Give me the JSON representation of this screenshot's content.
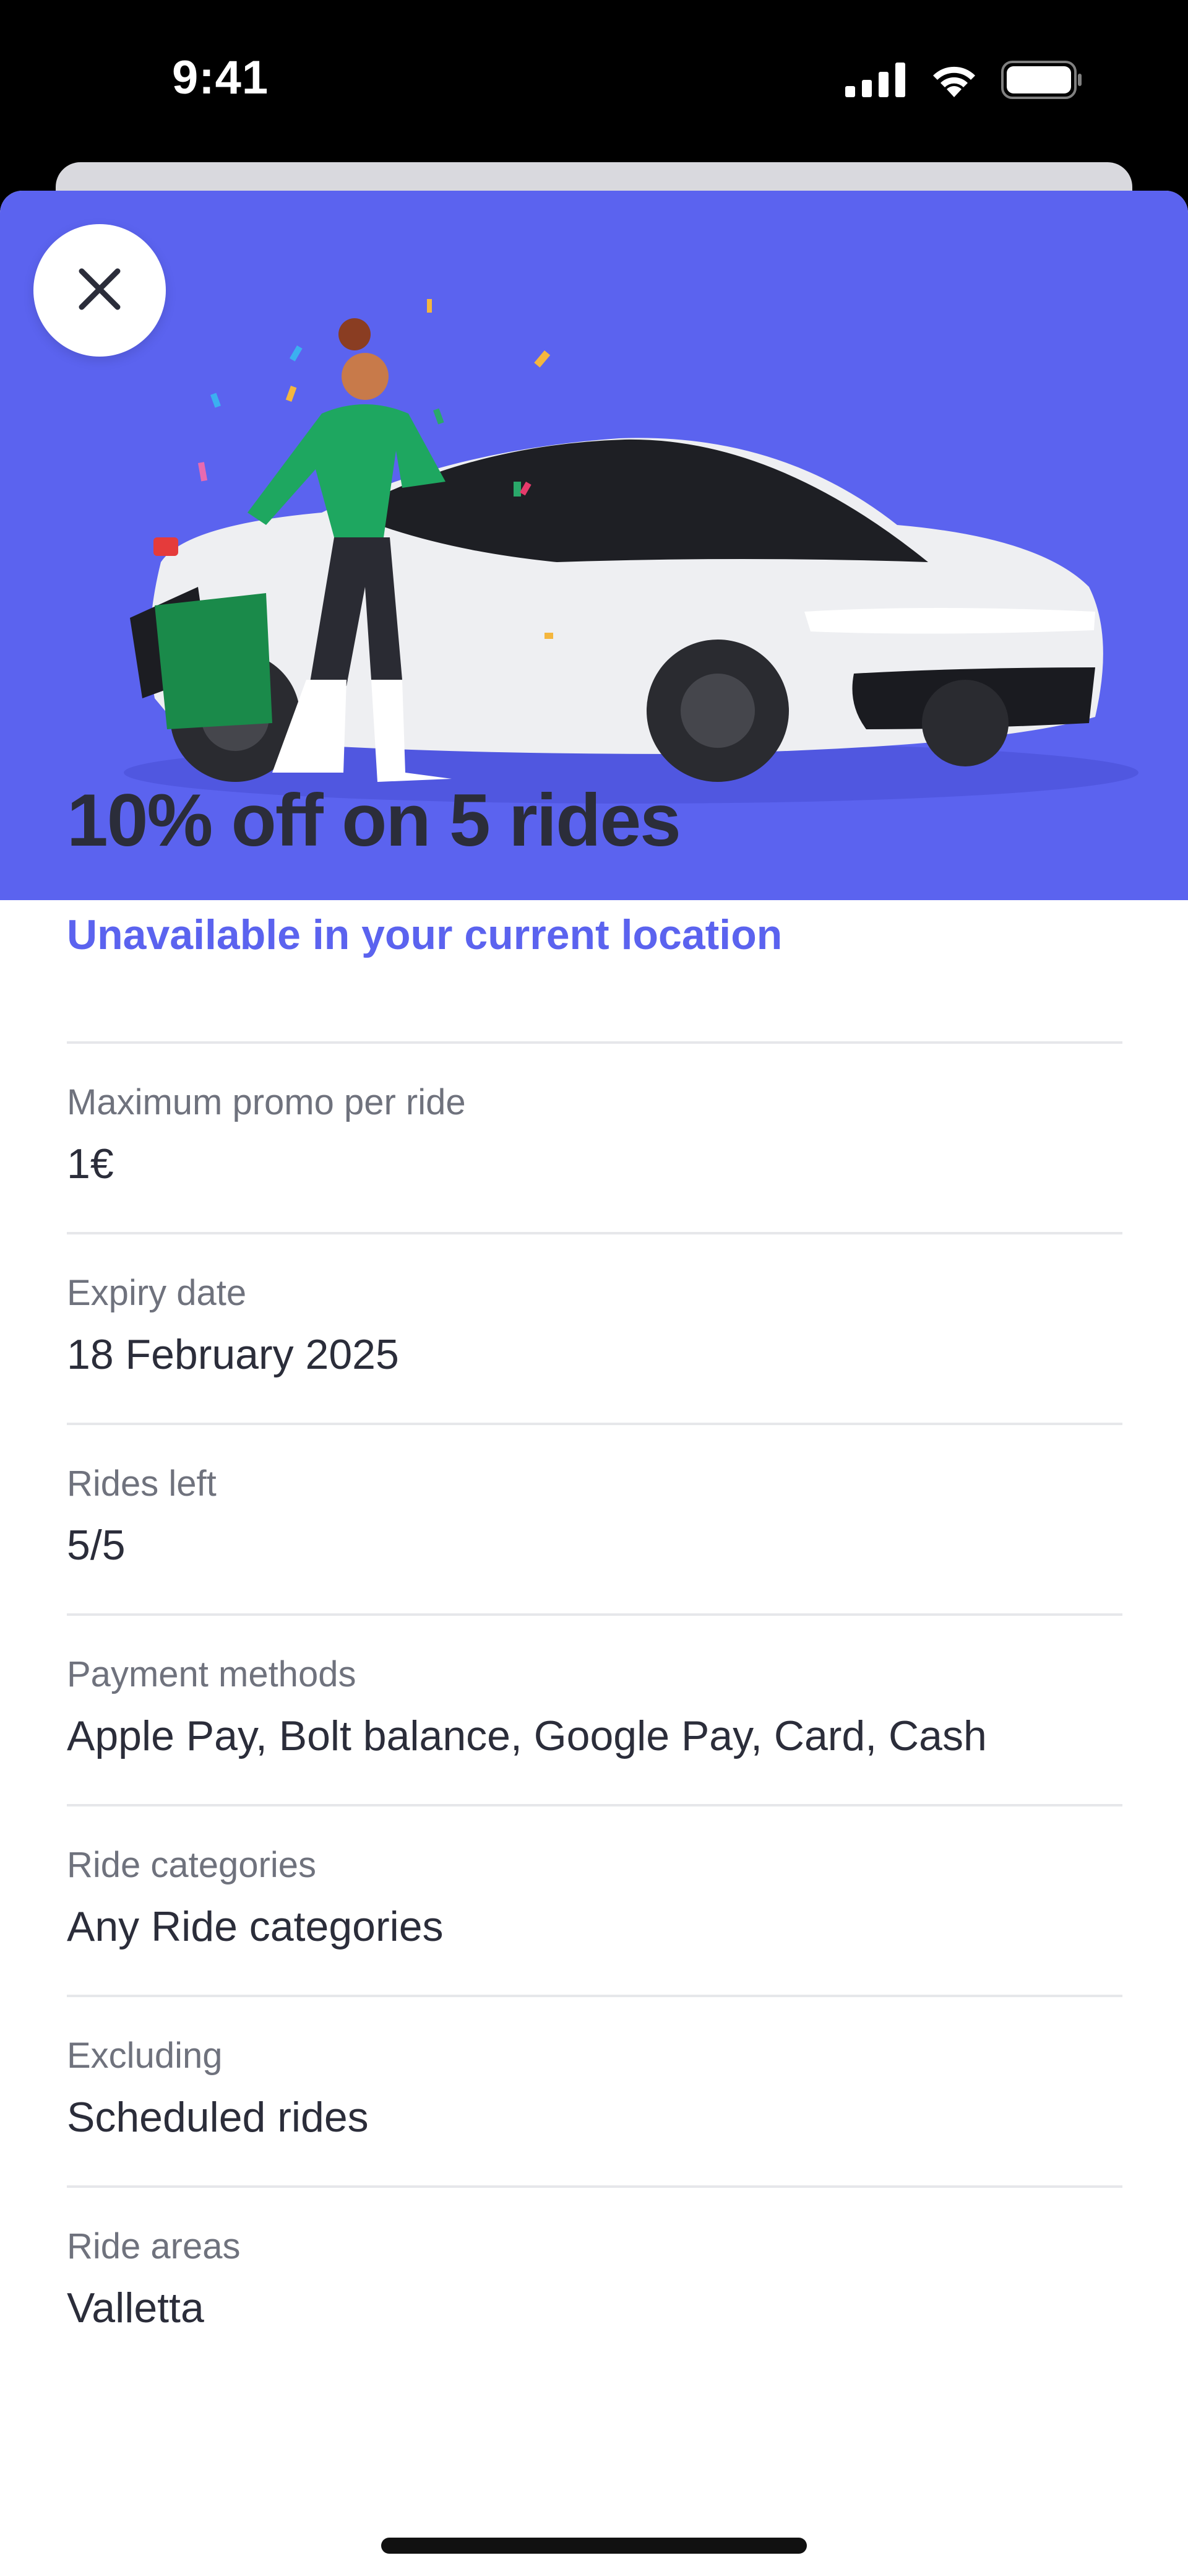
{
  "status_bar": {
    "time": "9:41",
    "icons": [
      "cellular-signal-icon",
      "wifi-icon",
      "battery-icon"
    ]
  },
  "hero": {
    "illustration": "woman-with-car-keys-and-shopping-bags-illustration",
    "background_color": "#5b63ef"
  },
  "close_icon": "close-icon",
  "promo": {
    "title": "10% off on 5 rides",
    "availability": "Unavailable in your current location"
  },
  "details": [
    {
      "label": "Maximum promo per ride",
      "value": "1€"
    },
    {
      "label": "Expiry date",
      "value": "18 February 2025"
    },
    {
      "label": "Rides left",
      "value": "5/5"
    },
    {
      "label": "Payment methods",
      "value": "Apple Pay, Bolt balance, Google Pay, Card, Cash"
    },
    {
      "label": "Ride categories",
      "value": "Any Ride categories"
    },
    {
      "label": "Excluding",
      "value": "Scheduled rides"
    },
    {
      "label": "Ride areas",
      "value": "Valletta"
    }
  ],
  "colors": {
    "accent": "#5b63ef",
    "text_primary": "#2b2d3a",
    "text_secondary": "#6f727d",
    "divider": "#e6e7ea"
  }
}
